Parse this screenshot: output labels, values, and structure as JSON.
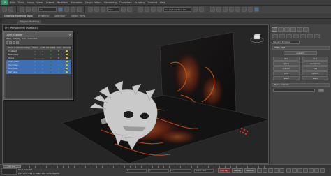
{
  "menu": {
    "app_logo": "3",
    "items": [
      "Edit",
      "Tools",
      "Group",
      "Views",
      "Create",
      "Modifiers",
      "Animation",
      "Graph Editors",
      "Rendering",
      "Customize",
      "Scripting",
      "Content",
      "Help"
    ]
  },
  "toolbar": {
    "selection_filter": "All",
    "view_dropdown": "View",
    "named_selection": "Create Selection Set"
  },
  "ribbon": {
    "tabs": [
      "Graphite Modeling Tools",
      "Freeform",
      "Selection",
      "Object Paint"
    ],
    "sub_label": "Polygon Modeling"
  },
  "viewport": {
    "label": "[+] [Perspective] [Realistic]"
  },
  "explorer": {
    "title": "Layer Explorer",
    "close": "×",
    "menu": [
      "Select",
      "Display",
      "Edit",
      "Customize"
    ],
    "columns": [
      "Name (Sorted Ascending)",
      "Hidden",
      "Frozen",
      "Renderable",
      "Color",
      "Radiosity"
    ],
    "rows": [
      {
        "name": "0 (default)",
        "selected": false
      },
      {
        "name": "Background",
        "selected": false
      },
      {
        "name": "Clouds",
        "selected": false
      },
      {
        "name": "Cloud_plane",
        "selected": true
      },
      {
        "name": "Floor_plane",
        "selected": true
      },
      {
        "name": "Skull_mesh",
        "selected": true
      },
      {
        "name": "Wall_plane",
        "selected": true
      }
    ]
  },
  "command_panel": {
    "object_type_select": "Standard Primitives",
    "rollout_object_type": "Object Type",
    "autogrid": "AutoGrid",
    "buttons": [
      "Box",
      "Cone",
      "Sphere",
      "GeoSphere",
      "Cylinder",
      "Tube",
      "Torus",
      "Pyramid",
      "Teapot",
      "Plane"
    ],
    "rollout_name_color": "Name and Color"
  },
  "timeline": {
    "slider": "0 / 100"
  },
  "status": {
    "message1": "None Selected",
    "message2": "Click and drag to select and move objects",
    "x_label": "X:",
    "y_label": "Y:",
    "z_label": "Z:",
    "grid": "Grid = 10.0",
    "auto_key": "Auto Key",
    "set_key": "Set Key",
    "selected": "Selected"
  },
  "colors": {
    "selection_blue": "#3f6fb3",
    "fire_orange": "#e0501a",
    "background": "#262626"
  }
}
